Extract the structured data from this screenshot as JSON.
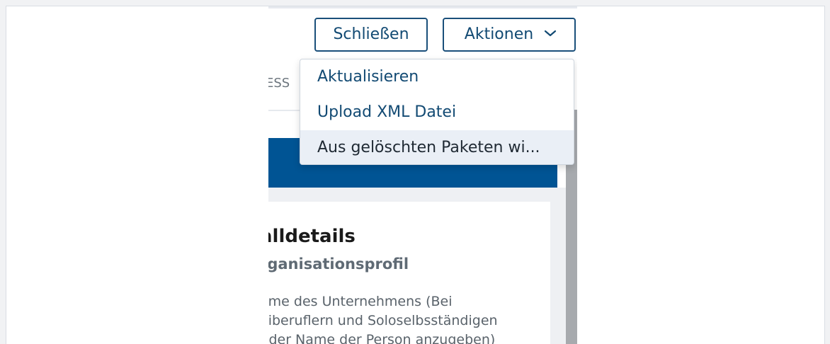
{
  "header": {
    "close_label": "Schließen",
    "actions_label": "Aktionen"
  },
  "actions_menu": {
    "items": [
      {
        "label": "Aktualisieren"
      },
      {
        "label": "Upload XML Datei"
      },
      {
        "label": "Aus gelöschten Paketen wi..."
      }
    ]
  },
  "tabs": {
    "partial_label": "ESS"
  },
  "card": {
    "title": "alldetails",
    "subtitle": "rganisationsprofil",
    "description_lines": [
      "ame des Unternehmens (Bei",
      "eiberuflern und Soloselbsständigen",
      ": der Name der Person anzugeben)"
    ]
  },
  "colors": {
    "brand_blue": "#005494",
    "button_border": "#1a4f7a",
    "text_link": "#124a73"
  },
  "icons": {
    "actions_chevron": "chevron-down-icon"
  }
}
